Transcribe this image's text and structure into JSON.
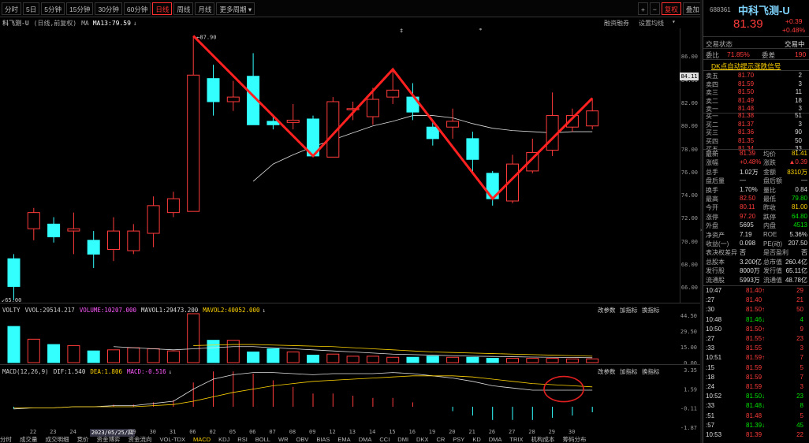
{
  "toolbar": {
    "periods": [
      "分时",
      "5日",
      "5分钟",
      "15分钟",
      "30分钟",
      "60分钟",
      "日线",
      "周线",
      "月线",
      "更多周期"
    ],
    "active_period": "日线",
    "period_dropdown_icon": "chevron-down-icon",
    "right_buttons": [
      "+",
      "−",
      "复权",
      "叠加",
      "筹码",
      "画线",
      "指标",
      "简约",
      "换精"
    ],
    "active_right": "复权"
  },
  "title": {
    "stock": "科飞测-U",
    "mode": "(日线,前复权)",
    "indicator": "MA",
    "ma": "MA13:79.59",
    "right1": "融资融券",
    "right2": "设置均线"
  },
  "markers": {
    "top1": "‡",
    "top2": "*"
  },
  "price_axis": {
    "ticks": [
      "86.00",
      "84.00",
      "82.00",
      "80.00",
      "78.00",
      "76.00",
      "74.00",
      "72.00",
      "70.00",
      "68.00",
      "66.00"
    ],
    "current": "84.11",
    "high_label": "87.90",
    "low_label": "65.00"
  },
  "chart_data": {
    "type": "candlestick",
    "candles": [
      {
        "o": 68.6,
        "c": 66.2,
        "h": 69.0,
        "l": 65.0,
        "up": false
      },
      {
        "o": 71.2,
        "c": 72.6,
        "h": 73.0,
        "l": 70.2,
        "up": true
      },
      {
        "o": 71.6,
        "c": 70.5,
        "h": 72.2,
        "l": 70.0,
        "up": false
      },
      {
        "o": 71.0,
        "c": 71.2,
        "h": 72.6,
        "l": 69.0,
        "up": true
      },
      {
        "o": 70.2,
        "c": 69.0,
        "h": 71.0,
        "l": 67.8,
        "up": false
      },
      {
        "o": 69.4,
        "c": 71.0,
        "h": 72.2,
        "l": 68.4,
        "up": true
      },
      {
        "o": 71.0,
        "c": 69.3,
        "h": 71.6,
        "l": 69.0,
        "up": true
      },
      {
        "o": 70.8,
        "c": 73.2,
        "h": 74.0,
        "l": 69.6,
        "up": true
      },
      {
        "o": 72.6,
        "c": 73.8,
        "h": 74.4,
        "l": 72.2,
        "up": true
      },
      {
        "o": 72.7,
        "c": 84.5,
        "h": 87.9,
        "l": 72.7,
        "up": true
      },
      {
        "o": 84.2,
        "c": 82.2,
        "h": 85.4,
        "l": 81.0,
        "up": false
      },
      {
        "o": 82.2,
        "c": 82.6,
        "h": 84.0,
        "l": 81.4,
        "up": true
      },
      {
        "o": 84.4,
        "c": 80.2,
        "h": 86.4,
        "l": 80.2,
        "up": false
      },
      {
        "o": 80.5,
        "c": 80.2,
        "h": 81.0,
        "l": 79.8,
        "up": false
      },
      {
        "o": 80.4,
        "c": 80.6,
        "h": 82.0,
        "l": 79.8,
        "up": true
      },
      {
        "o": 80.7,
        "c": 77.5,
        "h": 81.0,
        "l": 77.5,
        "up": false
      },
      {
        "o": 77.4,
        "c": 82.2,
        "h": 82.6,
        "l": 77.4,
        "up": true
      },
      {
        "o": 81.5,
        "c": 81.6,
        "h": 82.2,
        "l": 80.6,
        "up": true
      },
      {
        "o": 80.9,
        "c": 82.4,
        "h": 83.4,
        "l": 80.2,
        "up": true
      },
      {
        "o": 82.6,
        "c": 83.2,
        "h": 85.0,
        "l": 82.0,
        "up": true
      },
      {
        "o": 82.6,
        "c": 81.3,
        "h": 83.8,
        "l": 80.6,
        "up": false
      },
      {
        "o": 80.0,
        "c": 79.0,
        "h": 80.6,
        "l": 78.4,
        "up": false
      },
      {
        "o": 80.0,
        "c": 80.5,
        "h": 81.6,
        "l": 79.0,
        "up": true
      },
      {
        "o": 79.0,
        "c": 77.2,
        "h": 79.6,
        "l": 76.0,
        "up": false
      },
      {
        "o": 76.0,
        "c": 73.8,
        "h": 76.2,
        "l": 73.2,
        "up": false
      },
      {
        "o": 73.6,
        "c": 76.8,
        "h": 77.6,
        "l": 73.4,
        "up": true
      },
      {
        "o": 76.2,
        "c": 77.8,
        "h": 79.0,
        "l": 76.0,
        "up": true
      },
      {
        "o": 78.0,
        "c": 81.0,
        "h": 83.0,
        "l": 77.5,
        "up": true
      },
      {
        "o": 80.0,
        "c": 81.0,
        "h": 81.6,
        "l": 79.6,
        "up": true
      },
      {
        "o": 80.1,
        "c": 81.4,
        "h": 82.5,
        "l": 79.8,
        "up": true
      }
    ],
    "ma13": [
      null,
      null,
      null,
      null,
      null,
      null,
      null,
      null,
      null,
      null,
      null,
      null,
      75.3,
      76.8,
      77.6,
      78.3,
      78.9,
      79.5,
      80.1,
      80.5,
      81.0,
      81.0,
      80.8,
      80.3,
      79.9,
      79.7,
      79.6,
      79.5,
      79.6,
      79.6
    ],
    "zigzag": [
      [
        9,
        87.9
      ],
      [
        15,
        77.5
      ],
      [
        19,
        85.0
      ],
      [
        24,
        73.8
      ],
      [
        29,
        82.5
      ]
    ],
    "ylim": [
      65,
      88
    ]
  },
  "volume": {
    "header": [
      "VOLTY",
      "VVOL:29514.217",
      "VOLUME:10207.000",
      "MAVOL1:29473.200",
      "MAVOL2:40052.000"
    ],
    "right": [
      "改参数",
      "加指标",
      "换指标"
    ],
    "ticks": [
      "44.50",
      "29.50",
      "15.00",
      "0.00"
    ],
    "values": [
      34,
      22,
      17,
      16,
      11,
      12,
      14,
      13,
      11,
      46,
      21,
      21,
      10,
      13,
      10,
      7,
      8,
      6,
      6,
      5,
      5,
      6,
      5,
      5,
      4,
      4,
      4,
      4,
      3.5,
      3.5
    ],
    "mavol1": [
      null,
      null,
      null,
      null,
      null,
      15,
      14,
      13,
      12,
      13,
      14,
      15,
      15,
      14,
      13,
      12,
      11,
      10,
      9,
      8,
      7.5,
      7,
      6.5,
      6,
      5.8,
      5.5,
      5.2,
      5,
      4.8,
      4.6
    ],
    "mavol2": [
      null,
      null,
      null,
      null,
      null,
      null,
      null,
      null,
      null,
      16,
      16.5,
      17,
      17,
      16.5,
      16,
      15.5,
      15,
      14,
      13,
      12,
      11,
      10,
      9.5,
      9,
      8.5,
      8,
      7.5,
      7,
      6.5,
      6
    ]
  },
  "macd": {
    "header": [
      "MACD(12,26,9)",
      "DIF:1.540",
      "DEA:1.806",
      "MACD:-0.516"
    ],
    "right": [
      "改参数",
      "加指标",
      "换指标"
    ],
    "ticks": [
      "3.35",
      "1.59",
      "-0.11",
      "-1.87"
    ],
    "dif": [
      -0.2,
      -0.1,
      -0.1,
      0,
      0,
      0.1,
      0.1,
      0.3,
      0.5,
      1.6,
      2.5,
      2.9,
      3.1,
      3.1,
      3.0,
      2.9,
      3.0,
      3.0,
      3.0,
      3.1,
      3.0,
      2.8,
      2.6,
      2.3,
      1.9,
      1.7,
      1.5,
      1.5,
      1.5,
      1.5
    ],
    "dea": [
      -0.1,
      -0.1,
      -0.1,
      0,
      0,
      0,
      0,
      0.1,
      0.2,
      0.5,
      0.9,
      1.3,
      1.6,
      1.9,
      2.1,
      2.3,
      2.4,
      2.5,
      2.6,
      2.7,
      2.8,
      2.8,
      2.8,
      2.7,
      2.5,
      2.3,
      2.1,
      2.0,
      1.9,
      1.8
    ],
    "hist": [
      -0.2,
      0,
      0,
      0,
      0,
      0.2,
      0.2,
      0.4,
      0.6,
      2.2,
      3.2,
      3.2,
      3.0,
      2.4,
      1.8,
      1.2,
      1.2,
      1.0,
      0.8,
      0.8,
      0.4,
      0,
      -0.4,
      -0.8,
      -1.2,
      -1.2,
      -1.2,
      -1.0,
      -0.8,
      -0.5
    ]
  },
  "dates": [
    "22",
    "23",
    "24",
    "2023/05/25/四",
    "29",
    "30",
    "31",
    "06",
    "02",
    "05",
    "06",
    "07",
    "08",
    "09",
    "12",
    "13",
    "14",
    "15",
    "16",
    "19",
    "20",
    "21",
    "26",
    "27",
    "28",
    "29",
    "30"
  ],
  "bottom_tabs": [
    "分时",
    "成交量",
    "成交明细",
    "竞价",
    "资金博弈",
    "资金流向",
    "VOL-TDX",
    "MACD",
    "KDJ",
    "RSI",
    "BOLL",
    "WR",
    "OBV",
    "BIAS",
    "EMA",
    "DMA",
    "CCI",
    "DMI",
    "DKX",
    "CR",
    "PSY",
    "KD",
    "DMA",
    "TRIX",
    "机构成本",
    "筹码分布"
  ],
  "active_tab": "MACD",
  "panel": {
    "code": "688361",
    "name": "中科飞测-U",
    "price": "81.39",
    "change": "+0.39",
    "change_pct": "+0.48%",
    "trade_status_label": "交易状态",
    "trade_status": "交易中",
    "webi_label": "委比",
    "webi": "71.85%",
    "weicha_label": "委差",
    "weicha": "190",
    "dk_text": "DK点自动提示涨跌信号",
    "asks": [
      {
        "label": "卖五",
        "price": "81.70",
        "vol": "2"
      },
      {
        "label": "卖四",
        "price": "81.59",
        "vol": "3"
      },
      {
        "label": "卖三",
        "price": "81.50",
        "vol": "11"
      },
      {
        "label": "卖二",
        "price": "81.49",
        "vol": "18"
      },
      {
        "label": "卖一",
        "price": "81.48",
        "vol": "3"
      }
    ],
    "bids": [
      {
        "label": "买一",
        "price": "81.38",
        "vol": "51"
      },
      {
        "label": "买二",
        "price": "81.37",
        "vol": "3"
      },
      {
        "label": "买三",
        "price": "81.36",
        "vol": "90"
      },
      {
        "label": "买四",
        "price": "81.35",
        "vol": "50"
      },
      {
        "label": "买五",
        "price": "81.34",
        "vol": "33"
      }
    ],
    "stats": [
      [
        "最新",
        "81.39",
        "均价",
        "81.41"
      ],
      [
        "涨幅",
        "+0.48%",
        "涨跌",
        "▲0.39"
      ],
      [
        "总手",
        "1.02万",
        "金额",
        "8310万"
      ],
      [
        "盘后量",
        "—",
        "盘后额",
        "—"
      ],
      [
        "换手",
        "1.70%",
        "量比",
        "0.84"
      ],
      [
        "最高",
        "82.50",
        "最低",
        "79.80"
      ],
      [
        "今开",
        "80.11",
        "昨收",
        "81.00"
      ],
      [
        "涨停",
        "97.20",
        "跌停",
        "64.80"
      ],
      [
        "外盘",
        "5695",
        "内盘",
        "4513"
      ],
      [
        "净资产",
        "7.19",
        "ROE",
        "5.36%"
      ],
      [
        "收益(一)",
        "0.098",
        "PE(动)",
        "207.50"
      ],
      [
        "表决权差异",
        "否",
        "是否盈利",
        "否"
      ],
      [
        "总股本",
        "3.200亿",
        "总市值",
        "260.4亿"
      ],
      [
        "发行股",
        "8000万",
        "发行值",
        "65.11亿"
      ],
      [
        "流通股",
        "5993万",
        "流通值",
        "48.78亿"
      ]
    ],
    "trades": [
      [
        "10:47",
        "81.40↑",
        "29"
      ],
      [
        ":27",
        "81.40",
        "21"
      ],
      [
        ":30",
        "81.50↑",
        "50"
      ],
      [
        "10:48",
        "81.46↓",
        "4"
      ],
      [
        "10:50",
        "81.50↑",
        "9"
      ],
      [
        ":27",
        "81.55↑",
        "23"
      ],
      [
        ":33",
        "81.55",
        "3"
      ],
      [
        "10:51",
        "81.59↑",
        "7"
      ],
      [
        ":15",
        "81.59",
        "5"
      ],
      [
        ":18",
        "81.59",
        "7"
      ],
      [
        ":24",
        "81.59",
        "3"
      ],
      [
        "10:52",
        "81.50↓",
        "23"
      ],
      [
        ":33",
        "81.48↓",
        "8"
      ],
      [
        ":51",
        "81.48",
        "5"
      ],
      [
        ":57",
        "81.39↓",
        "45"
      ],
      [
        "10:53",
        "81.39",
        "22"
      ]
    ]
  }
}
